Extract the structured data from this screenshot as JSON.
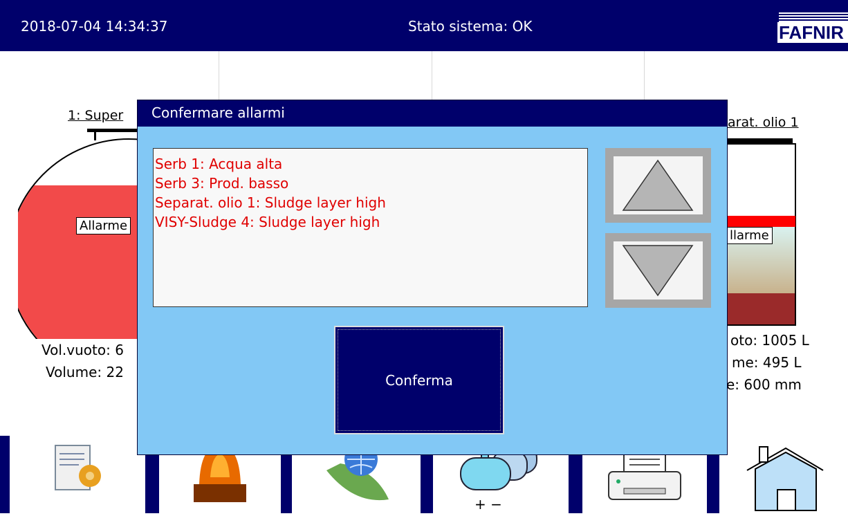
{
  "header": {
    "datetime": "2018-07-04  14:34:37",
    "status": "Stato sistema: OK",
    "logo_text": "FAFNIR"
  },
  "tanks": {
    "left": {
      "label": "1: Super",
      "tag": "Allarme",
      "vol_empty": "Vol.vuoto: 6",
      "volume": "Volume: 22",
      "fill_color": "#f24a4a"
    },
    "right": {
      "label": "arat. olio 1",
      "tag": "llarme",
      "vol_empty": "oto: 1005 L",
      "volume": "me: 495 L",
      "level": "e: 600 mm"
    }
  },
  "dialog": {
    "title": "Confermare allarmi",
    "alarms": [
      "Serb 1: Acqua alta",
      "Serb 3: Prod. basso",
      "Separat. olio 1: Sludge layer high",
      "VISY-Sludge 4: Sludge layer high"
    ],
    "scroll_up_icon": "triangle-up-icon",
    "scroll_down_icon": "triangle-down-icon",
    "confirm_label": "Conferma"
  },
  "toolbar": {
    "buttons": [
      {
        "icon": "document-gear-icon"
      },
      {
        "icon": "alarm-beacon-icon"
      },
      {
        "icon": "globe-leaf-icon"
      },
      {
        "icon": "tanks-plus-minus-icon"
      },
      {
        "icon": "printer-icon"
      },
      {
        "icon": "home-icon"
      }
    ]
  },
  "colors": {
    "primary_dark": "#00006b",
    "dialog_bg": "#82c8f5",
    "alarm_text": "#e00000"
  }
}
